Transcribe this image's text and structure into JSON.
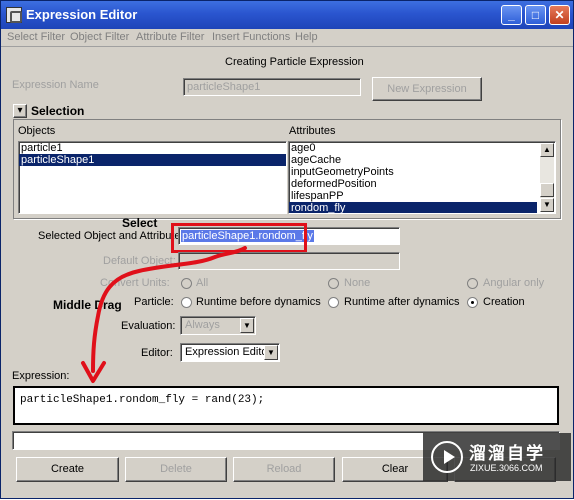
{
  "window": {
    "title": "Expression Editor",
    "min": "_",
    "max": "□",
    "close": "✕"
  },
  "menu": [
    "Select Filter",
    "Object Filter",
    "Attribute Filter",
    "Insert Functions",
    "Help"
  ],
  "heading": "Creating Particle Expression",
  "expression_name": {
    "label": "Expression Name",
    "value": "particleShape1",
    "new_button": "New Expression"
  },
  "selection": {
    "toggle": "▾",
    "title": "Selection",
    "objects_label": "Objects",
    "objects": [
      "particle1",
      "particleShape1"
    ],
    "objects_selected": 1,
    "attributes_label": "Attributes",
    "attributes": [
      "age0",
      "ageCache",
      "inputGeometryPoints",
      "deformedPosition",
      "lifespanPP",
      "rondom_fly"
    ],
    "attributes_selected": 5
  },
  "selected_attr": {
    "label": "Selected Object and Attribute:",
    "value": "particleShape1.rondom_fly"
  },
  "default_object": {
    "label": "Default Object:"
  },
  "convert_units": {
    "label": "Convert Units:",
    "options": [
      "All",
      "None",
      "Angular only"
    ]
  },
  "particle": {
    "label": "Particle:",
    "options": [
      "Runtime before dynamics",
      "Runtime after dynamics",
      "Creation"
    ],
    "selected": "Creation"
  },
  "evaluation": {
    "label": "Evaluation:",
    "value": "Always"
  },
  "editor": {
    "label": "Editor:",
    "value": "Expression Editor"
  },
  "expression": {
    "label": "Expression:",
    "code": "particleShape1.rondom_fly = rand(23);"
  },
  "buttons": {
    "create": "Create",
    "delete": "Delete",
    "reload": "Reload",
    "clear": "Clear"
  },
  "annotations": {
    "select": "Select",
    "middle_drag": "Middle Drag",
    "arrow_color": "#e0101a"
  },
  "watermark": {
    "brand": "溜溜自学",
    "url": "ZIXUE.3066.COM"
  }
}
